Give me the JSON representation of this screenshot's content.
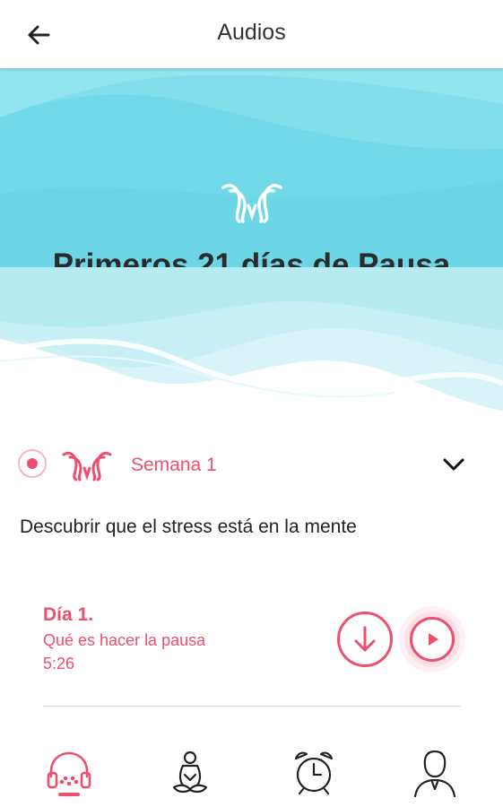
{
  "appbar": {
    "title": "Audios",
    "back_icon": "arrow-left-icon"
  },
  "hero": {
    "title": "Primeros 21 días de Pausa",
    "logo": "butterfly-logo-icon"
  },
  "week": {
    "label": "Semana 1",
    "expanded": false,
    "selected": true
  },
  "description": "Descubrir que el stress está en la mente",
  "day": {
    "title": "Día 1.",
    "subtitle": "Qué es hacer la pausa",
    "duration": "5:26"
  },
  "bottom_nav": {
    "items": [
      "headphones-icon",
      "meditation-icon",
      "alarm-clock-icon",
      "user-icon"
    ],
    "active": "headphones-icon"
  },
  "colors": {
    "accent": "#ee4f6e",
    "hero": "#7fdbe9",
    "text": "#222222"
  }
}
